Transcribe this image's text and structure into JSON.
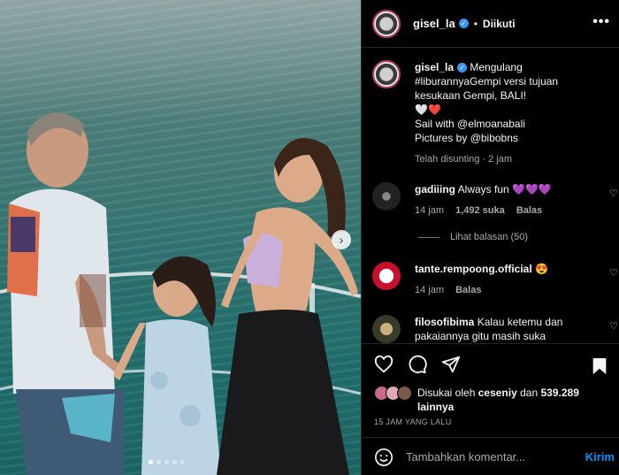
{
  "post": {
    "dots": 5,
    "active_dot": 1,
    "next_icon": "chevron-right-icon"
  },
  "header": {
    "username": "gisel_la",
    "separator": "•",
    "follow_label": "Diikuti",
    "more_icon": "more-horizontal-icon"
  },
  "caption": {
    "username": "gisel_la",
    "lines": [
      "Mengulang",
      "#liburannyaGempi versi tujuan",
      "kesukaan Gempi, BALI!",
      "🤍❤️",
      "Sail with @elmoanabali",
      "Pictures by @bibobns"
    ],
    "timestamp": "Telah disunting · 2 jam"
  },
  "comments": [
    {
      "username": "gadiiing",
      "text": "Always fun 💜💜💜",
      "time": "14 jam",
      "likes": "1,492 suka",
      "reply": "Balas"
    },
    {
      "username": "tante.rempoong.official",
      "text": "😍",
      "time": "14 jam",
      "reply": "Balas"
    },
    {
      "username": "filosofibima",
      "text": "Kalau ketemu dan pakaiannya gitu masih suka"
    }
  ],
  "view_replies": "Lihat balasan (50)",
  "likes": {
    "prefix": "Disukai oleh",
    "user": "ceseniy",
    "middle": "dan",
    "count": "539.289",
    "suffix": "lainnya"
  },
  "time_ago": "15 JAM YANG LALU",
  "add_comment": {
    "placeholder": "Tambahkan komentar...",
    "post_label": "Kirim"
  },
  "colors": {
    "accent": "#0095f6",
    "verified": "#3897f0",
    "background": "#000000"
  }
}
